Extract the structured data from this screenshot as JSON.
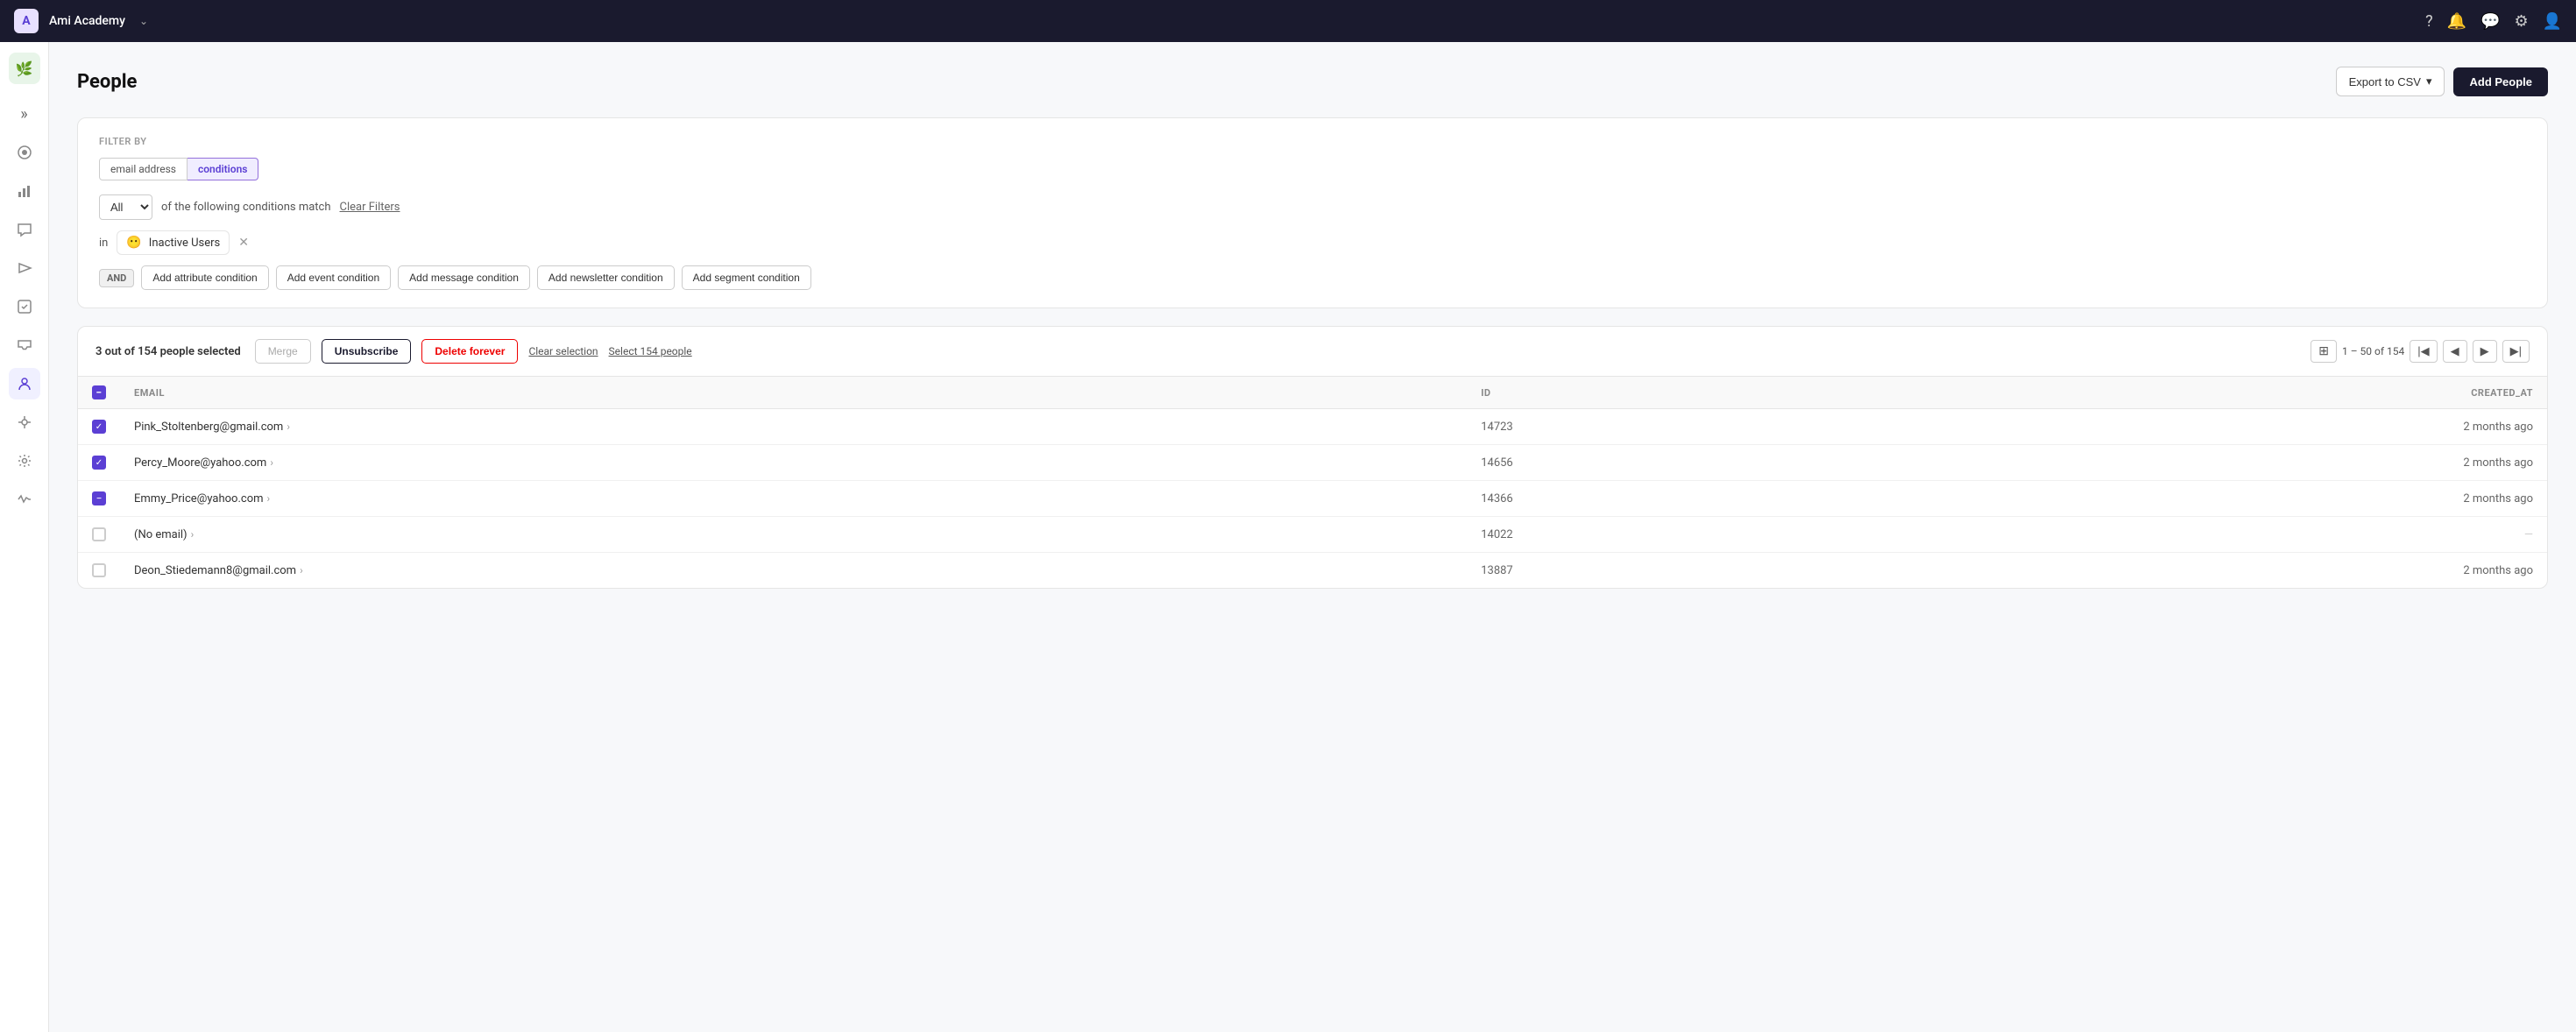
{
  "topbar": {
    "app_name": "Ami Academy",
    "chevron": "⌄",
    "icons": [
      "?",
      "🔔",
      "💬",
      "⚙",
      "👤"
    ]
  },
  "sidebar": {
    "logo": "🌿",
    "expand_icon": "»",
    "items": [
      {
        "id": "dashboard",
        "icon": "◉"
      },
      {
        "id": "analytics",
        "icon": "📊"
      },
      {
        "id": "messages",
        "icon": "💬"
      },
      {
        "id": "campaigns",
        "icon": "📣"
      },
      {
        "id": "automation",
        "icon": "▶"
      },
      {
        "id": "inbox",
        "icon": "📥"
      },
      {
        "id": "people",
        "icon": "👥"
      },
      {
        "id": "integrations",
        "icon": "🧩"
      },
      {
        "id": "settings",
        "icon": "👤"
      },
      {
        "id": "activity",
        "icon": "⚡"
      }
    ]
  },
  "page": {
    "title": "People",
    "export_label": "Export to CSV",
    "add_people_label": "Add People"
  },
  "filter": {
    "label": "FILTER BY",
    "tab_email": "email address",
    "tab_conditions": "conditions",
    "all_label": "All",
    "condition_text": "of the following conditions match",
    "clear_filters": "Clear Filters",
    "segment_label": "Inactive Users",
    "segment_icon": "😶",
    "and_label": "AND",
    "conditions": [
      {
        "label": "Add attribute condition"
      },
      {
        "label": "Add event condition"
      },
      {
        "label": "Add message condition"
      },
      {
        "label": "Add newsletter condition"
      },
      {
        "label": "Add segment condition"
      }
    ]
  },
  "toolbar": {
    "selected_text": "3 out of 154 people selected",
    "merge_label": "Merge",
    "unsubscribe_label": "Unsubscribe",
    "delete_label": "Delete forever",
    "clear_label": "Clear selection",
    "select_all_label": "Select 154 people",
    "page_info": "1 – 50 of 154"
  },
  "table": {
    "columns": [
      "EMAIL",
      "ID",
      "CREATED_AT"
    ],
    "rows": [
      {
        "email": "Pink_Stoltenberg@gmail.com",
        "id": "14723",
        "created_at": "2 months ago",
        "checked": "checked"
      },
      {
        "email": "Percy_Moore@yahoo.com",
        "id": "14656",
        "created_at": "2 months ago",
        "checked": "checked"
      },
      {
        "email": "Emmy_Price@yahoo.com",
        "id": "14366",
        "created_at": "2 months ago",
        "checked": "minus"
      },
      {
        "email": "(No email)",
        "id": "14022",
        "created_at": "—",
        "checked": "unchecked"
      },
      {
        "email": "Deon_Stiedemann8@gmail.com",
        "id": "13887",
        "created_at": "2 months ago",
        "checked": "unchecked"
      }
    ]
  }
}
